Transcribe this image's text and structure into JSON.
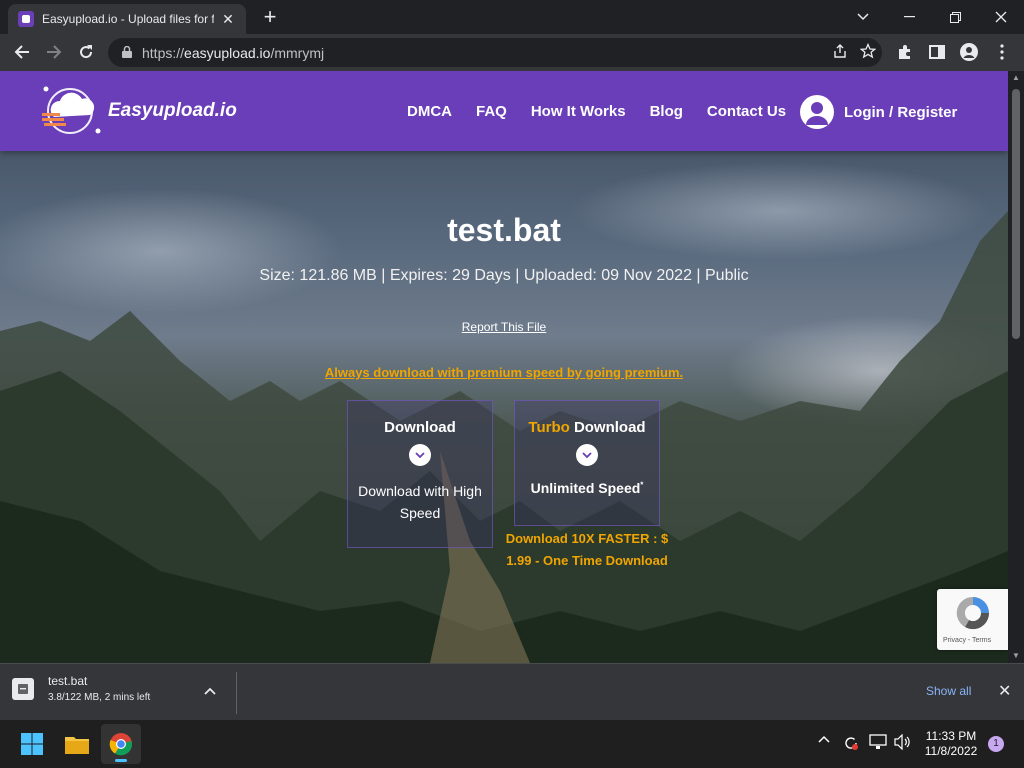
{
  "browser": {
    "tab_title": "Easyupload.io - Upload files for fr",
    "url_host": "easyupload.io",
    "url_prefix": "https://",
    "url_path": "/mmrymj"
  },
  "site": {
    "logo_text": "Easyupload.io",
    "nav": [
      "DMCA",
      "FAQ",
      "How It Works",
      "Blog",
      "Contact Us"
    ],
    "login_label": "Login / Register"
  },
  "file": {
    "name": "test.bat",
    "meta": "Size: 121.86 MB | Expires: 29 Days | Uploaded: 09 Nov 2022 | Public",
    "report_label": "Report This File",
    "premium_link": "Always download with premium speed by going premium."
  },
  "cards": {
    "download_title": "Download",
    "download_desc": "Download with High Speed",
    "turbo_word": "Turbo",
    "turbo_title": "Download",
    "turbo_speed": "Unlimited Speed",
    "turbo_promo": "Download 10X FASTER : $ 1.99 - One Time Download"
  },
  "recaptcha": {
    "text": "Privacy - Terms"
  },
  "download_shelf": {
    "file_name": "test.bat",
    "status": "3.8/122 MB, 2 mins left",
    "show_all": "Show all"
  },
  "taskbar": {
    "time": "11:33 PM",
    "date": "11/8/2022",
    "notification_count": "1"
  },
  "colors": {
    "brand": "#6a3eb8",
    "accent": "#f0a500"
  }
}
